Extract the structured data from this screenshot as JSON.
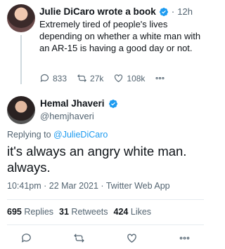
{
  "parent_tweet": {
    "author_name": "Julie DiCaro wrote a book",
    "separator": "·",
    "time": "12h",
    "text": "Extremely tired of people's lives depending on whether a white man with an AR-15 is having a good day or not.",
    "replies": "833",
    "retweets": "27k",
    "likes": "108k"
  },
  "main_tweet": {
    "author_name": "Hemal Jhaveri",
    "handle": "@hemjhaveri",
    "replying_prefix": "Replying to ",
    "replying_to": "@JulieDiCaro",
    "text": "it's always an angry white man. always.",
    "timestamp": "10:41pm · 22 Mar 2021 · Twitter Web App",
    "replies_count": "695",
    "replies_label": "Replies",
    "retweets_count": "31",
    "retweets_label": "Retweets",
    "likes_count": "424",
    "likes_label": "Likes"
  },
  "colors": {
    "accent": "#1d9bf0",
    "muted": "#536471",
    "text": "#0f1419"
  }
}
